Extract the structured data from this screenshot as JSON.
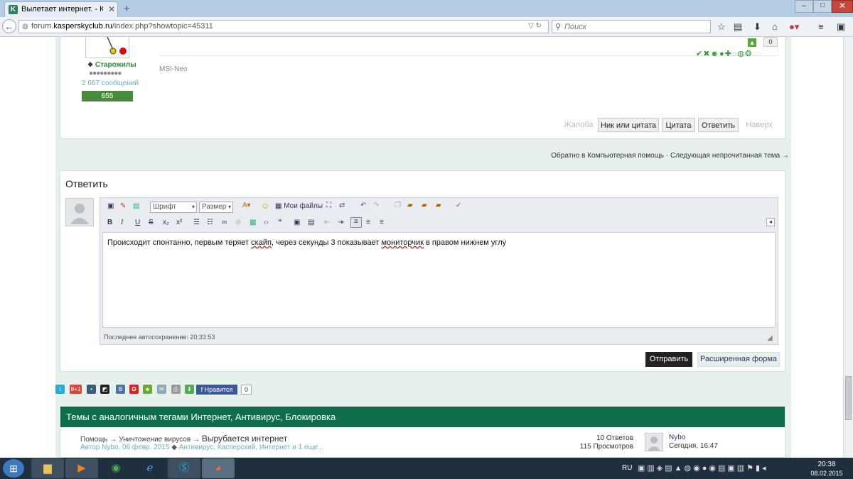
{
  "browser": {
    "tab_title": "Вылетает интернет. - Ком...",
    "tab_icon_letter": "K",
    "new_tab": "+",
    "url_prefix": "forum.",
    "url_domain": "kasperskyclub.ru",
    "url_path": "/index.php?showtopic=45311",
    "search_placeholder": "Поиск",
    "window_min": "–",
    "window_max": "□",
    "window_close": "✕"
  },
  "post": {
    "user_group": "Старожилы",
    "rank_dots": "●●●●●●●●●",
    "post_count": "2 667 сообщений",
    "reputation": "655",
    "signature": "MSI-Neo",
    "score": "0",
    "action_icons": "✔✖☻●✚◌◍❂",
    "buttons": {
      "report": "Жалоба",
      "nick_quote": "Ник или цитата",
      "quote": "Цитата",
      "reply": "Ответить",
      "top": "Наверх"
    }
  },
  "nav": {
    "back_to": "Обратно в Компьютерная помощь",
    "separator": " · ",
    "next_unread": "Следующая непрочитанная тема →"
  },
  "reply": {
    "title": "Ответить",
    "font_select": "Шрифт",
    "size_select": "Размер",
    "my_files": "Мои файлы",
    "text_before": "Происходит спонтанно, первым теряет ",
    "text_err1": "скайп",
    "text_mid": ", через секунды 3 показывает ",
    "text_err2": "мониторчик",
    "text_after": " в правом нижнем углу",
    "autosave": "Последнее автосохранение: 20:33:53",
    "submit": "Отправить",
    "full_form": "Расширенная форма"
  },
  "social": {
    "fb_like": "Нравится",
    "fb_count": "0"
  },
  "related": {
    "title": "Темы с аналогичным тегами Интернет, Антивирус, Блокировка",
    "crumb1": "Помощь",
    "crumb2": "Уничтожение вирусов",
    "arrow": " → ",
    "topic": "Вырубается интернет",
    "meta_author": "Автор Nybo, 06 февр. 2015",
    "meta_tags": "Антивирус, Касперский, Интернет и 1 еще...",
    "answers": "10 Ответов",
    "views": "115 Просмотров",
    "last_user": "Nybo",
    "last_time": "Сегодня, 16:47"
  },
  "taskbar": {
    "lang": "RU",
    "time": "20:38",
    "date": "08.02.2015"
  },
  "colors": {
    "accent_green": "#0f6e4a",
    "page_bg": "#e7f1ec",
    "link": "#6aaec0"
  }
}
